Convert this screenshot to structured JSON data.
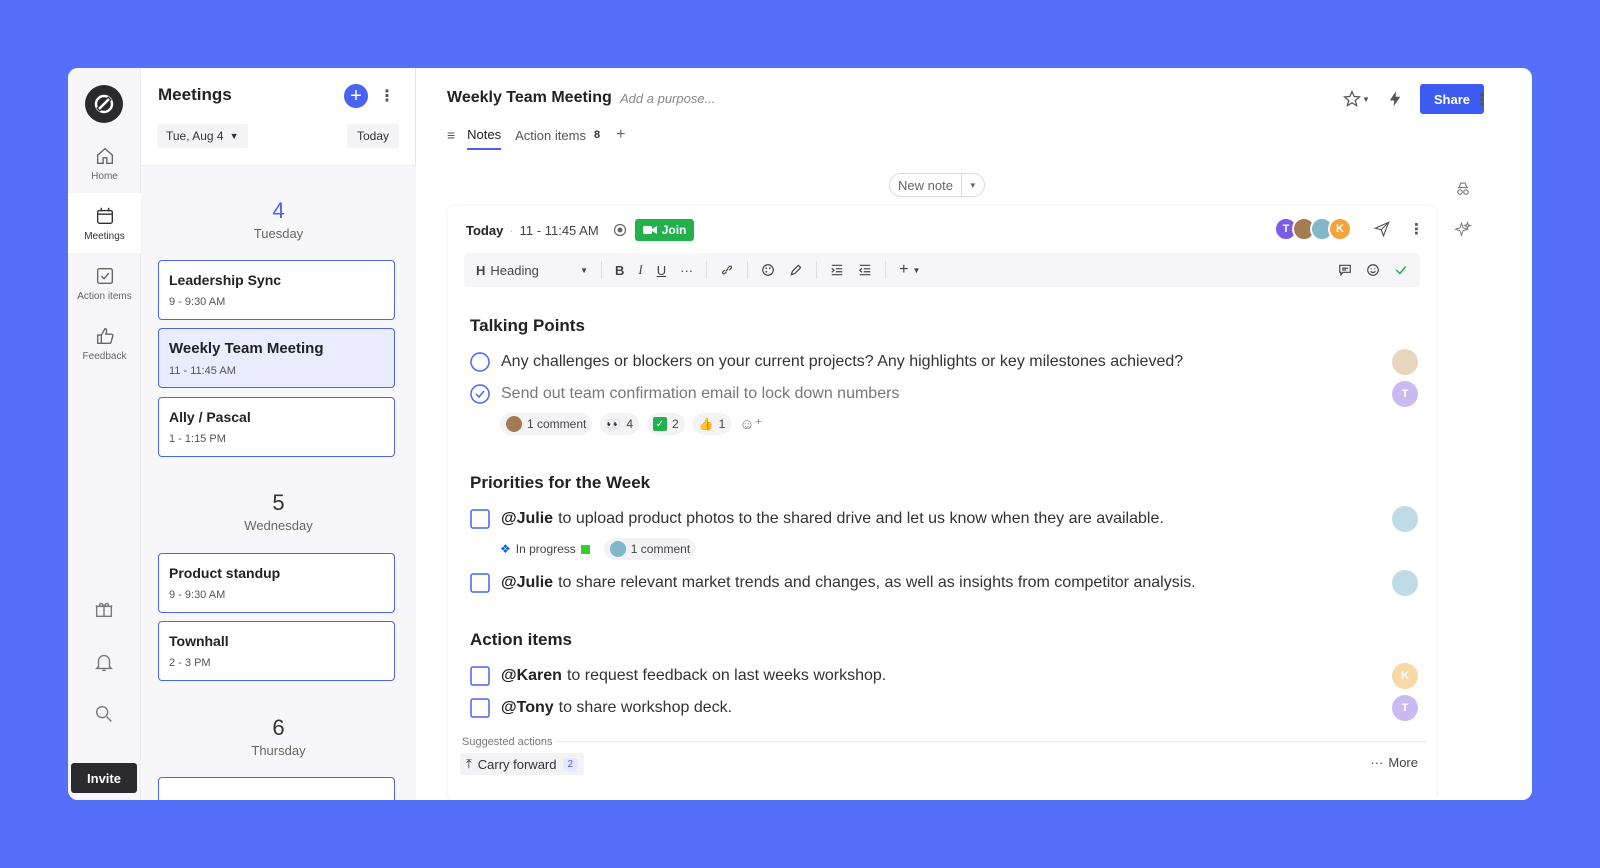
{
  "rail": {
    "nav": [
      {
        "label": "Home",
        "icon": "home-icon"
      },
      {
        "label": "Meetings",
        "icon": "calendar-icon"
      },
      {
        "label": "Action items",
        "icon": "checkbox-icon"
      },
      {
        "label": "Feedback",
        "icon": "thumbs-up-icon"
      }
    ],
    "invite_label": "Invite"
  },
  "meetings": {
    "title": "Meetings",
    "date": "Tue, Aug 4",
    "today_label": "Today",
    "days": [
      {
        "num": "4",
        "name": "Tuesday",
        "items": [
          {
            "title": "Leadership Sync",
            "time": "9 - 9:30 AM"
          },
          {
            "title": "Weekly Team Meeting",
            "time": "11 - 11:45 AM"
          },
          {
            "title": "Ally / Pascal",
            "time": "1 - 1:15 PM"
          }
        ]
      },
      {
        "num": "5",
        "name": "Wednesday",
        "items": [
          {
            "title": "Product standup",
            "time": "9 - 9:30 AM"
          },
          {
            "title": "Townhall",
            "time": "2 - 3 PM"
          }
        ]
      },
      {
        "num": "6",
        "name": "Thursday",
        "items": []
      }
    ]
  },
  "main": {
    "title": "Weekly Team Meeting",
    "purpose_placeholder": "Add a purpose...",
    "tabs": [
      {
        "label": "Notes"
      },
      {
        "label": "Action items",
        "count": "8"
      }
    ],
    "share_label": "Share",
    "new_note_label": "New note"
  },
  "note": {
    "day": "Today",
    "time": "11 - 11:45 AM",
    "join_label": "Join",
    "participants": [
      {
        "initial": "T",
        "color": "#7B5CE5"
      },
      {
        "initial": "",
        "color": "#A67B52"
      },
      {
        "initial": "",
        "color": "#7FB8C9"
      },
      {
        "initial": "K",
        "color": "#F4A43A"
      }
    ],
    "toolbar": {
      "heading_label": "Heading"
    },
    "sections": [
      {
        "heading": "Talking Points",
        "items": [
          {
            "text": "Any challenges or blockers on your current projects? Any highlights or key milestones achieved?",
            "done": false
          },
          {
            "text": "Send out team confirmation email to lock down numbers",
            "done": true
          }
        ],
        "chips": {
          "comment": "1 comment",
          "eyes": "4",
          "check": "2",
          "thumbs": "1"
        }
      },
      {
        "heading": "Priorities for the Week",
        "items": [
          {
            "mention": "@Julie",
            "text": "to upload product photos to the shared drive and let us know when they are available."
          },
          {
            "mention": "@Julie",
            "text": "to share relevant market trends and changes, as well as insights from competitor analysis."
          }
        ],
        "chips": {
          "status": "In progress",
          "comment": "1 comment"
        }
      },
      {
        "heading": "Action items",
        "items": [
          {
            "mention": "@Karen",
            "text": "to request feedback on last weeks workshop.",
            "avatar": "K"
          },
          {
            "mention": "@Tony",
            "text": "to share workshop deck.",
            "avatar": "T"
          }
        ]
      }
    ],
    "suggested_label": "Suggested actions",
    "carry_label": "Carry forward",
    "carry_count": "2",
    "more_label": "More",
    "talking_avatar_t": "T"
  },
  "colors": {
    "background": "#5470F9",
    "accent": "#4A63F0",
    "join": "#22B14C"
  }
}
